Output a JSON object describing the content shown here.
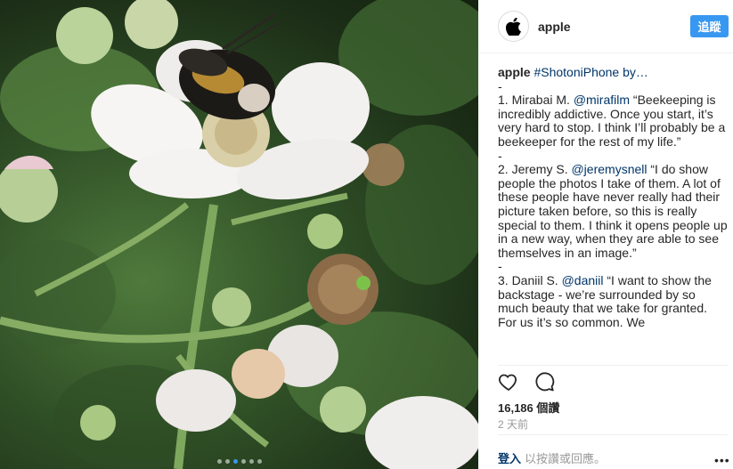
{
  "post": {
    "photo_alt": "Bumblebee on a white bramble flower",
    "carousel_dots": 6,
    "active_dot": 3
  },
  "header": {
    "username": "apple",
    "follow_label": "追蹤"
  },
  "caption": {
    "author": "apple",
    "intro": " #ShotoniPhone by…",
    "sep1": "-",
    "q1_prefix": "1. Mirabai M. ",
    "q1_handle": "@mirafilm",
    "q1_text": " “Beekeeping is incredibly addictive. Once you start, it’s very hard to stop. I think I’ll probably be a beekeeper for the rest of my life.”",
    "sep2": "-",
    "q2_prefix": "2. Jeremy S. ",
    "q2_handle": "@jeremysnell",
    "q2_text": " “I do show people the photos I take of them. A lot of these people have never really had their picture taken before, so this is really special to them. I think it opens people up in a new way, when they are able to see themselves in an image.”",
    "sep3": "-",
    "q3_prefix": "3. Daniil S. ",
    "q3_handle": "@daniil",
    "q3_text": " “I want to show the backstage - we’re surrounded by so much beauty that we take for granted. For us it’s so common. We"
  },
  "stats": {
    "likes": "16,186 個讚",
    "time": "2 天前"
  },
  "footer": {
    "login": "登入",
    "rest": "以按讚或回應。",
    "more": "•••"
  },
  "colors": {
    "accent": "#3897f0",
    "link": "#003569"
  },
  "icons": {
    "avatar": "apple-logo-icon",
    "like": "heart-icon",
    "comment": "comment-icon",
    "more": "more-options-icon"
  }
}
